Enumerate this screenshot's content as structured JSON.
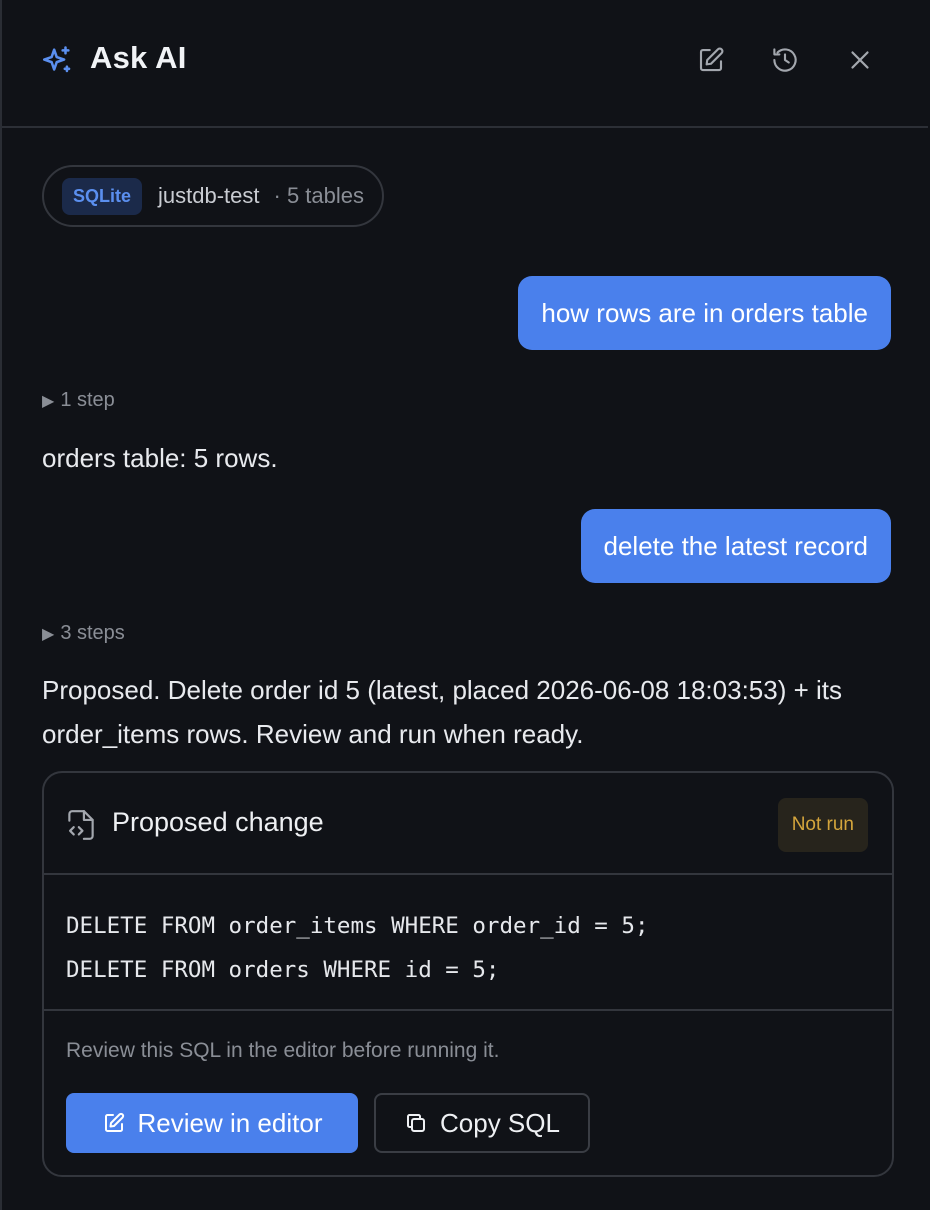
{
  "header": {
    "title": "Ask AI",
    "icons": [
      "sparkle-icon",
      "new-chat-icon",
      "history-icon",
      "close-icon"
    ],
    "accent_color": "#4a80ec"
  },
  "context": {
    "engine": "SQLite",
    "database": "justdb-test",
    "tables_label": "· 5 tables"
  },
  "messages": [
    {
      "role": "user",
      "text": "how rows are in orders table"
    },
    {
      "role": "assistant",
      "steps_label": "1 step",
      "text": "orders table: 5 rows."
    },
    {
      "role": "user",
      "text": "delete the latest record"
    },
    {
      "role": "assistant",
      "steps_label": "3 steps",
      "text": "Proposed. Delete order id 5 (latest, placed 2026-06-08 18:03:53) + its order_items rows. Review and run when ready."
    }
  ],
  "proposal": {
    "title": "Proposed change",
    "status": "Not run",
    "status_color": "#d4a53c",
    "sql_lines": [
      "DELETE FROM order_items WHERE order_id = 5;",
      "DELETE FROM orders WHERE id = 5;"
    ],
    "note": "Review this SQL in the editor before running it.",
    "review_button": "Review in editor",
    "copy_button": "Copy SQL"
  }
}
